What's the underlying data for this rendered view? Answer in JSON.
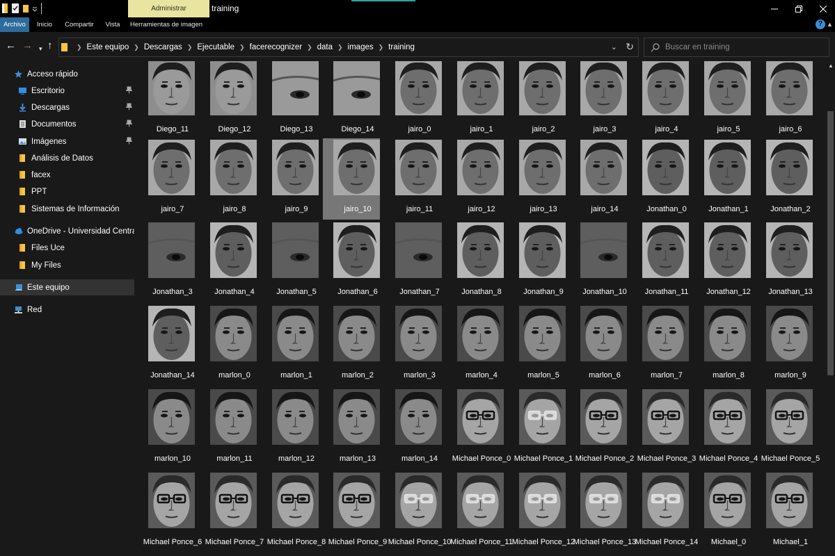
{
  "window": {
    "title": "training",
    "context_tab": "Administrar",
    "controls": [
      "minimize-icon",
      "maximize-icon",
      "close-icon"
    ]
  },
  "ribbon": {
    "tabs": [
      {
        "label": "Archivo",
        "active": true
      },
      {
        "label": "Inicio",
        "active": false
      },
      {
        "label": "Compartir",
        "active": false
      },
      {
        "label": "Vista",
        "active": false
      },
      {
        "label": "Herramientas de imagen",
        "active": false
      }
    ],
    "help_label": "?"
  },
  "address": {
    "crumbs": [
      "Este equipo",
      "Descargas",
      "Ejecutable",
      "facerecognizer",
      "data",
      "images",
      "training"
    ]
  },
  "search": {
    "placeholder": "Buscar en training",
    "value": ""
  },
  "sidebar": {
    "items": [
      {
        "label": "Acceso rápido",
        "icon": "star-icon",
        "pinned": false
      },
      {
        "label": "Escritorio",
        "icon": "desktop-icon",
        "pinned": true
      },
      {
        "label": "Descargas",
        "icon": "download-icon",
        "pinned": true
      },
      {
        "label": "Documentos",
        "icon": "document-icon",
        "pinned": true
      },
      {
        "label": "Imágenes",
        "icon": "image-icon",
        "pinned": true
      },
      {
        "label": "Análisis de Datos",
        "icon": "folder-icon",
        "pinned": false
      },
      {
        "label": "facex",
        "icon": "folder-icon",
        "pinned": false
      },
      {
        "label": "PPT",
        "icon": "folder-icon",
        "pinned": false
      },
      {
        "label": "Sistemas de Información",
        "icon": "folder-icon",
        "pinned": false
      },
      {
        "label": "OneDrive - Universidad Central del Ecu",
        "icon": "cloud-icon",
        "pinned": false
      },
      {
        "label": "Files Uce",
        "icon": "folder-icon",
        "pinned": false
      },
      {
        "label": "My Files",
        "icon": "folder-icon",
        "pinned": false
      },
      {
        "label": "Este equipo",
        "icon": "computer-icon",
        "pinned": false,
        "selected": true
      },
      {
        "label": "Red",
        "icon": "network-icon",
        "pinned": false
      }
    ]
  },
  "files": [
    "Diego_11",
    "Diego_12",
    "Diego_13",
    "Diego_14",
    "jairo_0",
    "jairo_1",
    "jairo_2",
    "jairo_3",
    "jairo_4",
    "jairo_5",
    "jairo_6",
    "jairo_7",
    "jairo_8",
    "jairo_9",
    "jairo_10",
    "jairo_11",
    "jairo_12",
    "jairo_13",
    "jairo_14",
    "Jonathan_0",
    "Jonathan_1",
    "Jonathan_2",
    "Jonathan_3",
    "Jonathan_4",
    "Jonathan_5",
    "Jonathan_6",
    "Jonathan_7",
    "Jonathan_8",
    "Jonathan_9",
    "Jonathan_10",
    "Jonathan_11",
    "Jonathan_12",
    "Jonathan_13",
    "Jonathan_14",
    "marlon_0",
    "marlon_1",
    "marlon_2",
    "marlon_3",
    "marlon_4",
    "marlon_5",
    "marlon_6",
    "marlon_7",
    "marlon_8",
    "marlon_9",
    "marlon_10",
    "marlon_11",
    "marlon_12",
    "marlon_13",
    "marlon_14",
    "Michael Ponce_0",
    "Michael Ponce_1",
    "Michael Ponce_2",
    "Michael Ponce_3",
    "Michael Ponce_4",
    "Michael Ponce_5",
    "Michael Ponce_6",
    "Michael Ponce_7",
    "Michael Ponce_8",
    "Michael Ponce_9",
    "Michael Ponce_10",
    "Michael Ponce_11",
    "Michael Ponce_12",
    "Michael Ponce_13",
    "Michael Ponce_14",
    "Michael_0",
    "Michael_1"
  ],
  "selected_file": "jairo_10",
  "colors": {
    "accent": "#2d6b9c",
    "context_tab": "#e9e5a0",
    "background": "#191919"
  }
}
